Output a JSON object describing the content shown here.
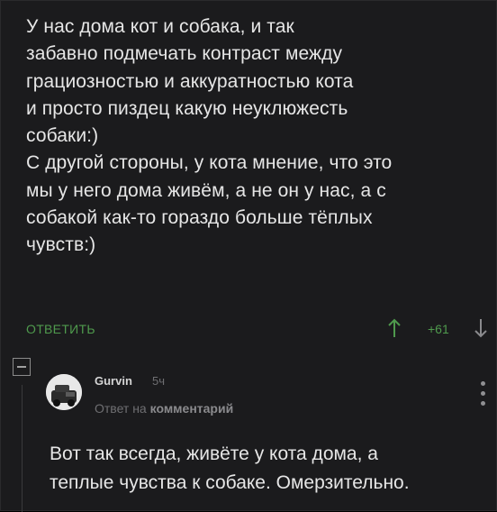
{
  "post": {
    "paragraph_1": "У нас дома кот и собака, и так\nзабавно подмечать контраст между\nграциозностью и аккуратностью кота\nи просто пиздец какую неуклюжесть\nсобаки:)",
    "paragraph_2": "С другой стороны, у кота мнение, что это\nмы у него дома живём, а не он у нас, а с\nсобакой как-то гораздо больше тёплых\nчувств:)"
  },
  "actions": {
    "reply_label": "ОТВЕТИТЬ",
    "rating": "+61",
    "upvote_icon": "arrow-up-icon",
    "downvote_icon": "arrow-down-icon"
  },
  "reply": {
    "username": "Gurvin",
    "time_ago": "5ч",
    "reply_to_prefix": "Ответ на",
    "reply_to_link": "комментарий",
    "text": "Вот так всегда, живёте у кота дома, а\nтеплые чувства к собаке. Омерзительно."
  },
  "colors": {
    "background": "#1b1b1d",
    "text": "#e6e6e6",
    "accent_green": "#4f9a4d",
    "muted": "#6f6f72"
  }
}
